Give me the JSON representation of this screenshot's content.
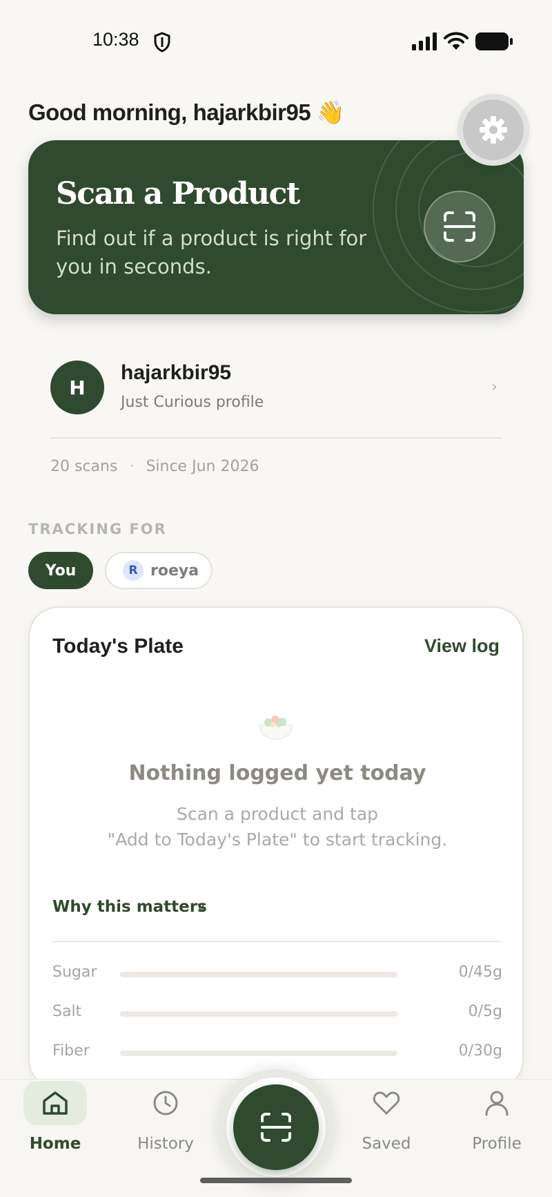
{
  "status_bar": {
    "time": "10:38"
  },
  "greeting": {
    "text": "Good morning, hajarkbir95",
    "emoji": "👋"
  },
  "scan_card": {
    "title": "Scan a Product",
    "subtitle": "Find out if a product is right for you in seconds."
  },
  "profile": {
    "initial": "H",
    "name": "hajarkbir95",
    "subtitle": "Just Curious profile",
    "chevron": "›",
    "scans": "20 scans",
    "separator": "·",
    "since": "Since Jun 2026"
  },
  "tracking": {
    "label": "TRACKING FOR",
    "chips": [
      {
        "label": "You",
        "active": true
      },
      {
        "initial": "R",
        "label": "roeya",
        "active": false
      }
    ]
  },
  "plate": {
    "title": "Today's Plate",
    "view_log": "View log",
    "empty_title": "Nothing logged yet today",
    "empty_subtitle": "Scan a product and tap\n\"Add to Today's Plate\" to start tracking.",
    "why_label": "Why this matters",
    "why_chevron": "∨",
    "nutrients": [
      {
        "name": "Sugar",
        "value": "0/45g",
        "fraction": 0
      },
      {
        "name": "Salt",
        "value": "0/5g",
        "fraction": 0
      },
      {
        "name": "Fiber",
        "value": "0/30g",
        "fraction": 0
      }
    ]
  },
  "nav": {
    "items": [
      {
        "label": "Home",
        "icon": "home-icon",
        "active": true
      },
      {
        "label": "History",
        "icon": "clock-icon",
        "active": false
      },
      {
        "label": "Saved",
        "icon": "heart-icon",
        "active": false
      },
      {
        "label": "Profile",
        "icon": "person-icon",
        "active": false
      }
    ]
  },
  "colors": {
    "brand_green": "#2f4a2e",
    "background": "#f8f7f4"
  }
}
